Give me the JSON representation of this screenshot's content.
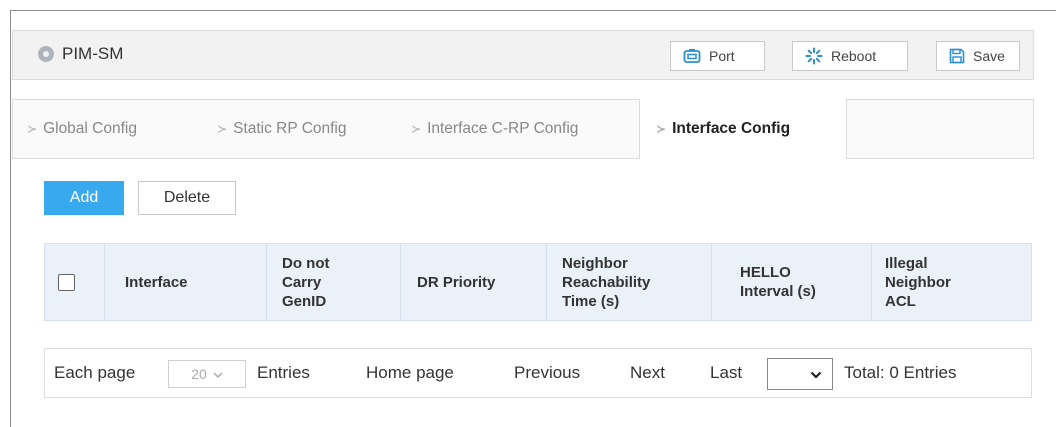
{
  "header": {
    "title": "PIM-SM",
    "title_icon": "location-dot-icon",
    "buttons": {
      "port": "Port",
      "reboot": "Reboot",
      "save": "Save"
    }
  },
  "tabs": [
    {
      "label": "Global Config",
      "active": false
    },
    {
      "label": "Static RP Config",
      "active": false
    },
    {
      "label": "Interface C-RP Config",
      "active": false
    },
    {
      "label": "Interface Config",
      "active": true
    }
  ],
  "actions": {
    "add": "Add",
    "delete": "Delete"
  },
  "table": {
    "columns": [
      "Interface",
      "Do not Carry GenID",
      "DR Priority",
      "Neighbor Reachability Time (s)",
      "HELLO Interval (s)",
      "Illegal Neighbor ACL"
    ],
    "rows": []
  },
  "pager": {
    "each_page": "Each page",
    "page_size": "20",
    "entries": "Entries",
    "home": "Home page",
    "previous": "Previous",
    "next": "Next",
    "last": "Last",
    "total": "Total: 0 Entries"
  },
  "colors": {
    "accent": "#38a8ef",
    "header_bg": "#eaf1f9",
    "icon_blue": "#2b8fd6"
  }
}
